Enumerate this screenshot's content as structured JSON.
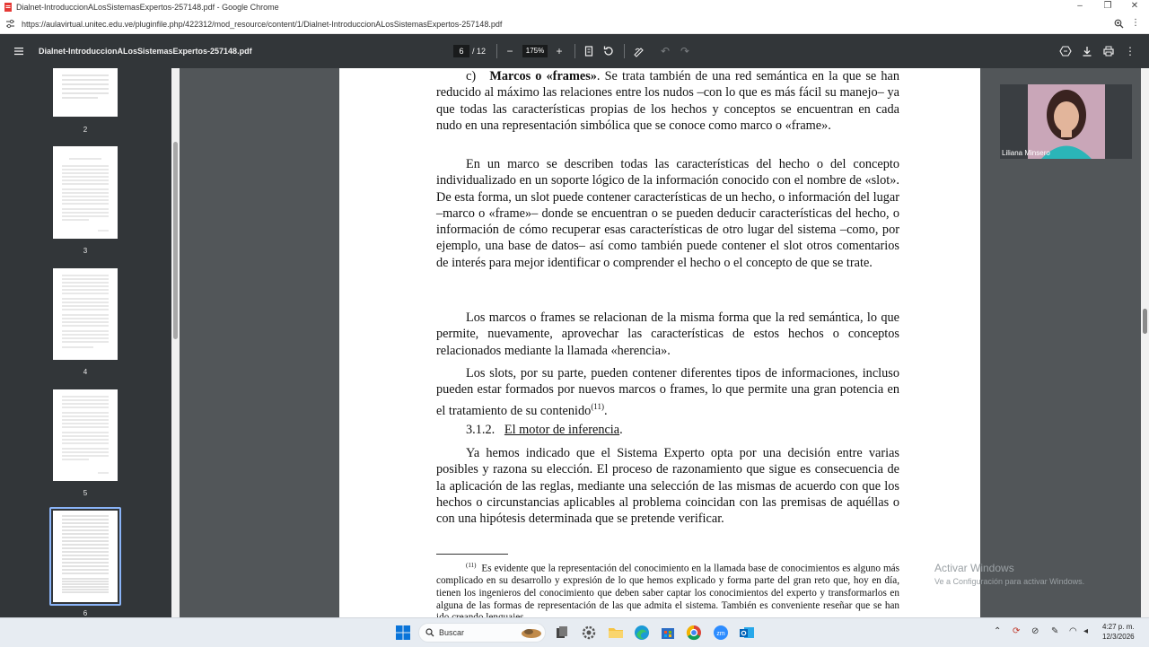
{
  "window": {
    "title": "Dialnet-IntroduccionALosSistemasExpertos-257148.pdf - Google Chrome",
    "minimize": "–",
    "restore": "❐",
    "close": "✕"
  },
  "address_bar": {
    "url": "https://aulavirtual.unitec.edu.ve/pluginfile.php/422312/mod_resource/content/1/Dialnet-IntroduccionALosSistemasExpertos-257148.pdf"
  },
  "pdf_toolbar": {
    "doc_name": "Dialnet-IntroduccionALosSistemasExpertos-257148.pdf",
    "current_page": "6",
    "total_pages": "/ 12",
    "zoom": "175%"
  },
  "thumbnails": [
    {
      "label": "2"
    },
    {
      "label": "3"
    },
    {
      "label": "4"
    },
    {
      "label": "5"
    },
    {
      "label": "6"
    }
  ],
  "document": {
    "para1_prefix": "c)   ",
    "para1_bold": "Marcos o «frames»",
    "para1_rest": ". Se trata también de una red semántica en la que se han reducido al máximo las relaciones entre los nudos –con lo que es más fácil su manejo– ya que todas las características propias de los hechos y conceptos se encuentran en cada nudo en una representación simbólica que se conoce como marco o «frame».",
    "para2": "En un marco se describen todas las características del hecho o del concepto individualizado en un soporte lógico de la información conocido con el nombre de «slot». De esta forma, un slot puede contener características de un hecho, o información del lugar –marco o «frame»– donde se encuentran o se pueden deducir características del hecho, o información de cómo recuperar esas características de otro lugar del sistema –como, por ejemplo, una base de datos– así como también puede contener el slot otros comentarios de interés para mejor identificar o comprender el hecho o el concepto de que se trate.",
    "para3": "Los marcos o frames se relacionan de la misma forma que la red semántica, lo que permite, nuevamente, aprovechar las características de estos hechos o conceptos relacionados mediante la llamada «herencia».",
    "para4": "Los slots, por su parte, pueden contener diferentes tipos de informaciones, incluso pueden estar formados por nuevos marcos o frames, lo que permite una gran potencia en el tratamiento de su contenido",
    "para4_sup": "(11)",
    "para4_end": ".",
    "heading_num": "3.1.2.",
    "heading_text": "El motor de inferencia",
    "heading_end": ".",
    "para5": "Ya hemos indicado que el Sistema Experto opta por una decisión entre varias posibles y razona su elección. El proceso de razonamiento que sigue es consecuencia de la aplicación de las reglas, mediante una selección de las mismas de acuerdo con que los hechos o circunstancias aplicables al problema coincidan con las premisas de aquéllas o con una hipótesis determinada que se pretende verificar.",
    "footnote_mark": "(11)",
    "footnote": "Es evidente que la representación del conocimiento en la llamada base de conocimientos es alguno más complicado en su desarrollo y expresión de lo que hemos explicado y forma parte del gran reto que, hoy en día, tienen los ingenieros del conocimiento que deben saber captar los conocimientos del experto y transformarlos en alguna de las formas de representación de las que admita el sistema. También es conveniente reseñar que se han ido creando lenguajes"
  },
  "video": {
    "participant": "Liliana Minsero"
  },
  "watermark": {
    "line1": "Activar Windows",
    "line2": "Ve a Configuración para activar Windows."
  },
  "taskbar": {
    "search_label": "Buscar",
    "time": "4:27 p. m.",
    "date": "12/3/2026"
  },
  "icons": {
    "window_icon": "pdf-icon",
    "menu": "hamburger-icon",
    "rotate": "rotate-icon",
    "download": "download-icon",
    "print": "print-icon"
  }
}
